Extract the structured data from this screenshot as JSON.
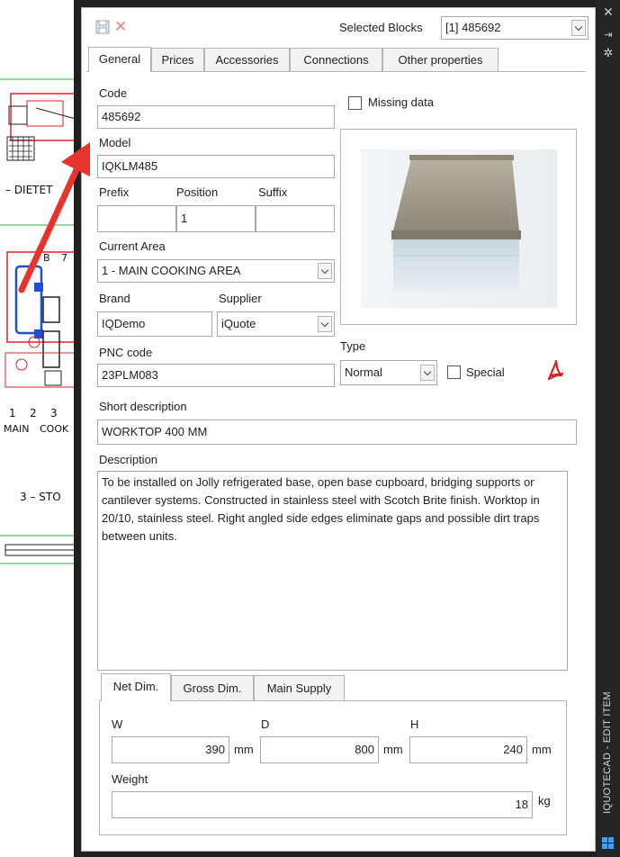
{
  "cad": {
    "labels": [
      "– DIETET",
      "B",
      "7",
      "1",
      "2",
      "3",
      "MAIN",
      "COOK",
      "3 – STO"
    ]
  },
  "titlebar": {
    "selected_blocks_label": "Selected Blocks",
    "selected_blocks_value": "[1] 485692"
  },
  "tabs": [
    "General",
    "Prices",
    "Accessories",
    "Connections",
    "Other properties"
  ],
  "general": {
    "code_label": "Code",
    "code_value": "485692",
    "missing_data_label": "Missing data",
    "model_label": "Model",
    "model_value": "IQKLM485",
    "prefix_label": "Prefix",
    "position_label": "Position",
    "suffix_label": "Suffix",
    "prefix_value": "",
    "position_value": "1",
    "suffix_value": "",
    "current_area_label": "Current Area",
    "current_area_value": "1 - MAIN COOKING AREA",
    "brand_label": "Brand",
    "brand_value": "IQDemo",
    "supplier_label": "Supplier",
    "supplier_value": "iQuote",
    "pnc_label": "PNC code",
    "pnc_value": "23PLM083",
    "type_label": "Type",
    "type_value": "Normal",
    "special_label": "Special",
    "short_desc_label": "Short description",
    "short_desc_value": "WORKTOP 400 MM",
    "desc_label": "Description",
    "desc_value": "To be installed on Jolly refrigerated base, open base cupboard, bridging supports or cantilever systems. Constructed in stainless steel with Scotch Brite finish. Worktop in 20/10, stainless steel. Right angled side edges eliminate gaps and possible dirt traps between units."
  },
  "dim_tabs": [
    "Net Dim.",
    "Gross Dim.",
    "Main Supply"
  ],
  "dims": {
    "w_label": "W",
    "w_value": "390",
    "w_unit": "mm",
    "d_label": "D",
    "d_value": "800",
    "d_unit": "mm",
    "h_label": "H",
    "h_value": "240",
    "h_unit": "mm",
    "weight_label": "Weight",
    "weight_value": "18",
    "weight_unit": "kg"
  },
  "sidebar": {
    "title": "IQUOTECAD - EDIT ITEM",
    "icons": [
      "close-icon",
      "pin-icon",
      "settings-icon",
      "windows-logo-icon"
    ]
  },
  "colors": {
    "frame": "#202020",
    "arrow": "#e8322c",
    "cad_red": "#e0202a",
    "cad_blue": "#1a4fd8",
    "pdf_red": "#d9241c"
  }
}
